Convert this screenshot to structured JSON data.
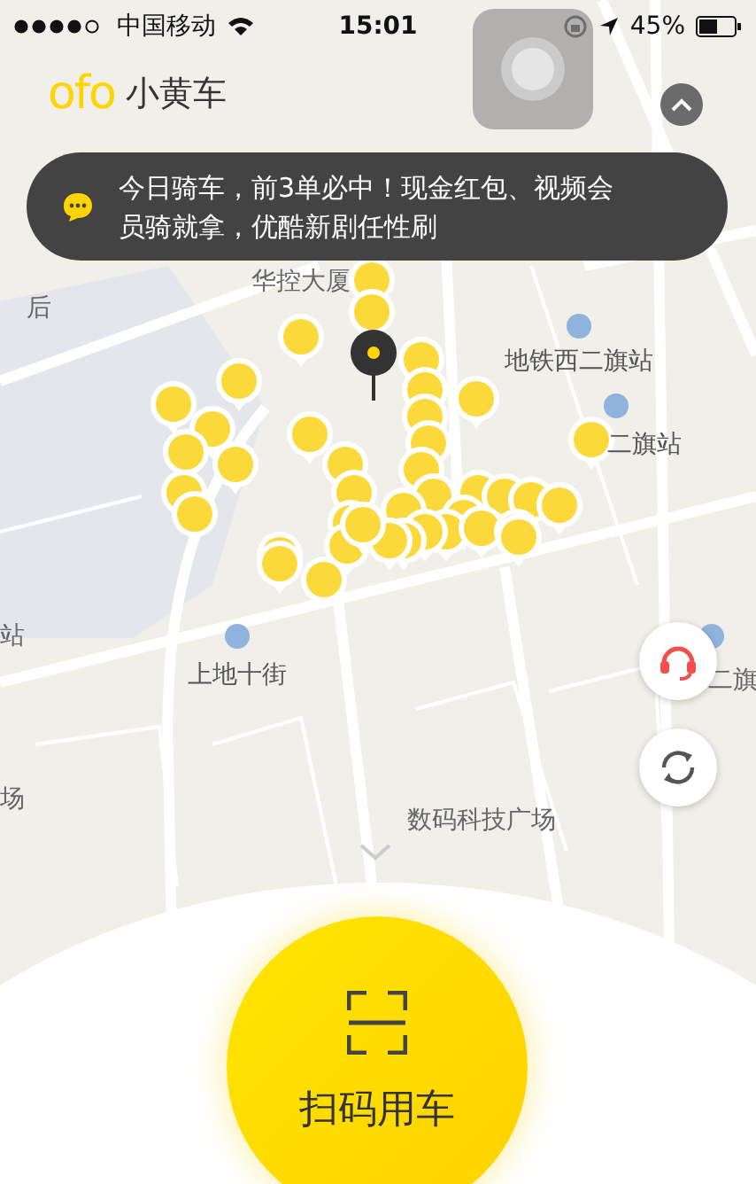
{
  "status_bar": {
    "carrier": "中国移动",
    "time": "15:01",
    "battery": "45%"
  },
  "header": {
    "logo": "ofo",
    "title": "小黄车"
  },
  "notice": {
    "text": "今日骑车，前3单必中！现金红包、视频会员骑就拿，优酷新剧任性刷"
  },
  "map": {
    "labels": [
      {
        "text": "后",
        "kind": "area"
      },
      {
        "text": "华控大厦",
        "kind": "area"
      },
      {
        "text": "地铁西二旗站",
        "kind": "station"
      },
      {
        "text": "二旗站",
        "kind": "station"
      },
      {
        "text": "站",
        "kind": "area"
      },
      {
        "text": "上地十街",
        "kind": "station"
      },
      {
        "text": "二旗",
        "kind": "area"
      },
      {
        "text": "场",
        "kind": "area"
      },
      {
        "text": "数码科技广场",
        "kind": "building"
      }
    ]
  },
  "scan_button": {
    "label": "扫码用车"
  }
}
